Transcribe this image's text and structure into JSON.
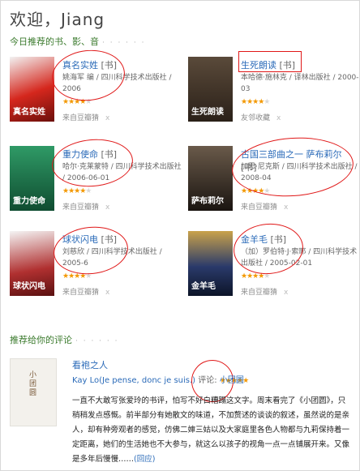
{
  "page": {
    "greeting": "欢迎，Jiang"
  },
  "books_section": {
    "title": "今日推荐的书、影、音",
    "dots": "· · · · · ·",
    "books": [
      {
        "title": "真名实姓",
        "tag": "[书]",
        "meta": "姚海军 编 / 四川科学技术出版社 / 2006",
        "rating": 4,
        "source": "来自豆瓣猜",
        "dismiss": "x",
        "cover_label": "真名实姓",
        "cover_color": "#d5271d"
      },
      {
        "title": "生死朗读",
        "tag": "[书]",
        "meta": "本哈德·施林克 / 译林出版社 / 2000-03",
        "rating": 4,
        "source": "友邻收藏",
        "dismiss": "x",
        "cover_label": "生死朗读",
        "cover_color": "#4a3a2a"
      },
      {
        "title": "重力使命",
        "tag": "[书]",
        "meta": "哈尔·克莱蒙特 / 四川科学技术出版社 / 2006-06-01",
        "rating": 4,
        "source": "来自豆瓣猜",
        "dismiss": "x",
        "cover_label": "重力使命",
        "cover_color": "#1e7d52"
      },
      {
        "title": "古国三部曲之一 萨布莉尔",
        "tag": "[书]",
        "meta": "加思·尼克斯 / 四川科学技术出版社 / 2008-04",
        "rating": 4,
        "source": "来自豆瓣猜",
        "dismiss": "x",
        "cover_label": "萨布莉尔",
        "cover_color": "#3a2f28"
      },
      {
        "title": "球状闪电",
        "tag": "[书]",
        "meta": "刘慈欣 / 四川科学技术出版社 / 2005-6",
        "rating": 4,
        "source": "来自豆瓣猜",
        "dismiss": "x",
        "cover_label": "球状闪电",
        "cover_color": "#8a2b2b"
      },
      {
        "title": "金羊毛",
        "tag": "[书]",
        "meta": "（加）罗伯特·J·索耶 / 四川科学技术出版社 / 2005-02-01",
        "rating": 4,
        "source": "来自豆瓣猜",
        "dismiss": "x",
        "cover_label": "金羊毛",
        "cover_color": "#1b2b4a"
      }
    ]
  },
  "reviews_section": {
    "title": "推荐给你的评论",
    "dots": "· · · · · ·",
    "review": {
      "title": "看袍之人",
      "author": "Kay Lo(Je pense, donc je suis.)",
      "verb": "评论:",
      "book": "小团圆",
      "rating": 5,
      "body": "一直不大敢写张爱玲的书评，怕写不好白糟蹋这文字。周末看完了《小团圆》，只稍稍发点感慨。前半部分有她散文的味道，不加赘述的谈谈的叙述，虽然说的是亲人，却有种旁观者的感觉，仿佛二婶三姑以及大家庭里各色人物都与九莉保持着一定距离，她们的生活她也不大参与，就这么以孩子的视角一点一点铺展开来。又像是多年后慢慢……",
      "more": "(回应)",
      "cover_text": "小团圆"
    }
  },
  "colors": {
    "link": "#2a6ab8",
    "accent_green": "#3a7a2c",
    "star": "#f39800",
    "annotation": "#e01818"
  }
}
